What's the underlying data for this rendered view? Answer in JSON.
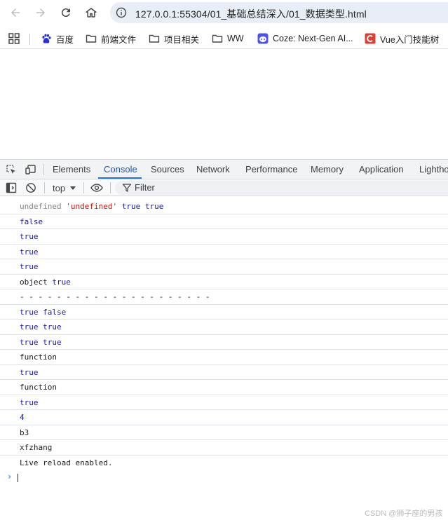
{
  "browser": {
    "url": "127.0.0.1:55304/01_基础总结深入/01_数据类型.html",
    "bookmarks": [
      {
        "label": "百度",
        "icon": "baidu-paw-icon"
      },
      {
        "label": "前端文件",
        "icon": "folder-icon"
      },
      {
        "label": "项目相关",
        "icon": "folder-icon"
      },
      {
        "label": "WW",
        "icon": "folder-icon"
      },
      {
        "label": "Coze: Next-Gen AI...",
        "icon": "coze-icon"
      },
      {
        "label": "Vue入门技能树",
        "icon": "csdn-icon"
      }
    ]
  },
  "devtools": {
    "tabs": [
      "Elements",
      "Console",
      "Sources",
      "Network",
      "Performance",
      "Memory",
      "Application",
      "Lighthouse"
    ],
    "active_tab": "Console",
    "context": "top",
    "filter_placeholder": "Filter",
    "lines": [
      [
        {
          "t": "undefined",
          "c": "grey"
        },
        {
          "t": " ",
          "c": "text"
        },
        {
          "t": "'undefined'",
          "c": "str"
        },
        {
          "t": " true true",
          "c": "blue"
        }
      ],
      [
        {
          "t": "false",
          "c": "blue"
        }
      ],
      [
        {
          "t": "true",
          "c": "blue"
        }
      ],
      [
        {
          "t": "true",
          "c": "blue"
        }
      ],
      [
        {
          "t": "true",
          "c": "blue"
        }
      ],
      [
        {
          "t": "object",
          "c": "text"
        },
        {
          "t": " true",
          "c": "blue"
        }
      ],
      [
        {
          "t": "- - - - - - - - - - - - - - - - - - - - -",
          "c": "text"
        }
      ],
      [
        {
          "t": "true false",
          "c": "blue"
        }
      ],
      [
        {
          "t": "true true",
          "c": "blue"
        }
      ],
      [
        {
          "t": "true true",
          "c": "blue"
        }
      ],
      [
        {
          "t": "function",
          "c": "text"
        }
      ],
      [
        {
          "t": "true",
          "c": "blue"
        }
      ],
      [
        {
          "t": "function",
          "c": "text"
        }
      ],
      [
        {
          "t": "true",
          "c": "blue"
        }
      ],
      [
        {
          "t": "4",
          "c": "blue"
        }
      ],
      [
        {
          "t": "b3",
          "c": "text"
        }
      ],
      [
        {
          "t": "xfzhang",
          "c": "text"
        }
      ],
      [
        {
          "t": "Live reload enabled.",
          "c": "text"
        }
      ]
    ]
  },
  "watermark": "CSDN @狮子座的男孩"
}
